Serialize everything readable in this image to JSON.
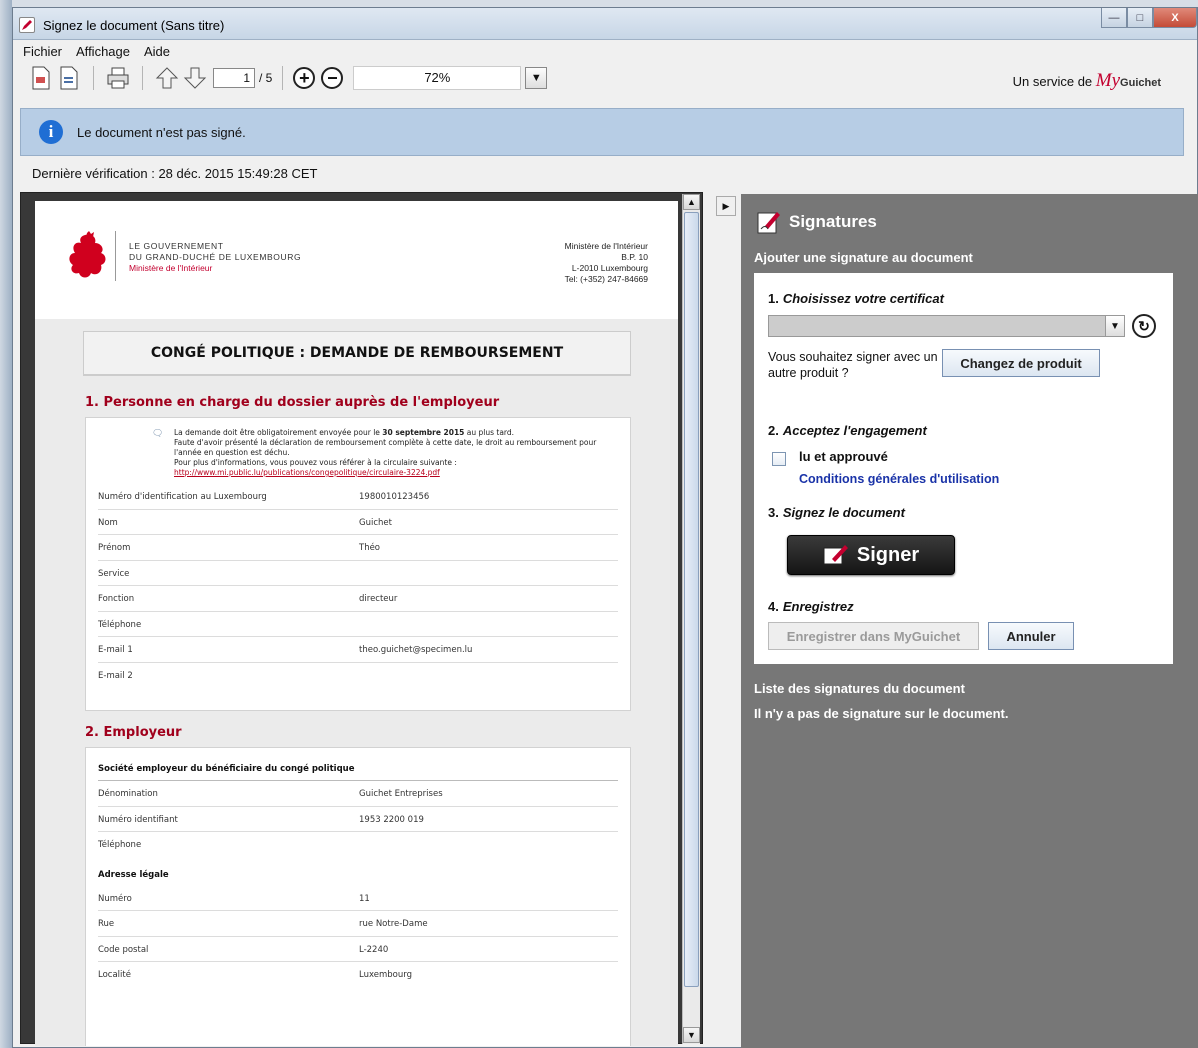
{
  "window": {
    "title": "Signez le document (Sans titre)",
    "minimize": "—",
    "maximize": "□",
    "close": "X"
  },
  "menu": {
    "file": "Fichier",
    "view": "Affichage",
    "help": "Aide"
  },
  "toolbar": {
    "page_current": "1",
    "page_total": "/ 5",
    "zoom_in": "+",
    "zoom_out": "−",
    "zoom_value": "72%",
    "service_prefix": "Un service de",
    "brand_my": "My",
    "brand_guichet": "Guichet"
  },
  "info": {
    "message": "Le document n'est pas signé."
  },
  "last_check": "Dernière vérification : 28 déc. 2015 15:49:28 CET",
  "document": {
    "gov_line1": "LE GOUVERNEMENT",
    "gov_line2": "DU GRAND-DUCHÉ DE LUXEMBOURG",
    "gov_line3": "Ministère de l'Intérieur",
    "ministry_name": "Ministère de l'Intérieur",
    "ministry_bp": "B.P. 10",
    "ministry_city": "L-2010 Luxembourg",
    "ministry_tel": "Tel: (+352) 247-84669",
    "title": "CONGÉ POLITIQUE : DEMANDE DE REMBOURSEMENT",
    "section1_title": "1. Personne en charge du dossier auprès de l'employeur",
    "notice_line1_a": "La demande doit être obligatoirement envoyée pour le ",
    "notice_line1_b": "30 septembre 2015",
    "notice_line1_c": " au plus tard.",
    "notice_line2": "Faute d'avoir présenté la déclaration de remboursement complète à cette date, le droit au remboursement pour l'année en question est déchu.",
    "notice_line3": "Pour plus d'informations, vous pouvez vous référer à la circulaire suivante : ",
    "notice_link": "http://www.mi.public.lu/publications/congepolitique/circulaire-3224.pdf",
    "section1_rows": [
      {
        "label": "Numéro d'identification au Luxembourg",
        "value": "1980010123456"
      },
      {
        "label": "Nom",
        "value": "Guichet"
      },
      {
        "label": "Prénom",
        "value": "Théo"
      },
      {
        "label": "Service",
        "value": ""
      },
      {
        "label": "Fonction",
        "value": "directeur"
      },
      {
        "label": "Téléphone",
        "value": ""
      },
      {
        "label": "E-mail 1",
        "value": "theo.guichet@specimen.lu"
      },
      {
        "label": "E-mail 2",
        "value": ""
      }
    ],
    "section2_title": "2. Employeur",
    "section2_subheading": "Société employeur du bénéficiaire du congé politique",
    "section2_rows": [
      {
        "label": "Dénomination",
        "value": "Guichet Entreprises"
      },
      {
        "label": "Numéro identifiant",
        "value": "1953 2200 019"
      },
      {
        "label": "Téléphone",
        "value": ""
      }
    ],
    "address_heading": "Adresse légale",
    "address_rows": [
      {
        "label": "Numéro",
        "value": "11"
      },
      {
        "label": "Rue",
        "value": "rue Notre-Dame"
      },
      {
        "label": "Code postal",
        "value": "L-2240"
      },
      {
        "label": "Localité",
        "value": "Luxembourg"
      }
    ]
  },
  "signatures": {
    "title": "Signatures",
    "add_label": "Ajouter une signature au document",
    "step1_num": "1.",
    "step1_label": "Choisissez votre certificat",
    "other_product_text": "Vous souhaitez signer avec un autre produit ?",
    "change_product_button": "Changez de produit",
    "step2_num": "2.",
    "step2_label": "Acceptez l'engagement",
    "checkbox_label": "lu et approuvé",
    "terms_link": "Conditions générales d'utilisation",
    "step3_num": "3.",
    "step3_label": "Signez le document",
    "sign_button": "Signer",
    "step4_num": "4.",
    "step4_label": "Enregistrez",
    "save_button": "Enregistrer dans MyGuichet",
    "cancel_button": "Annuler",
    "list_heading": "Liste des signatures du document",
    "list_empty": "Il n'y a pas de signature sur le document."
  }
}
